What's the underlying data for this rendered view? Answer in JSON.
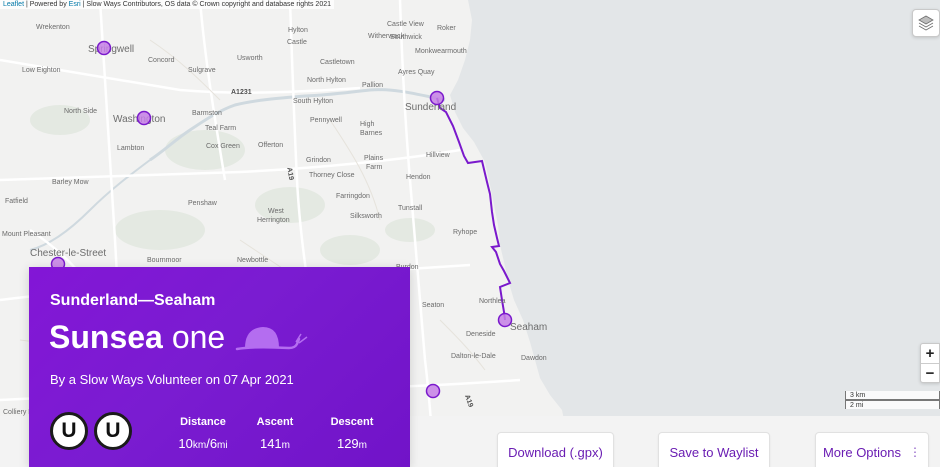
{
  "attribution": {
    "leaflet": "Leaflet",
    "sep1": " | Powered by ",
    "esri": "Esri",
    "rest": " | Slow Ways Contributors, OS data © Crown copyright and database rights 2021"
  },
  "map": {
    "towns": [
      "Sunderland",
      "Washington",
      "Seaham",
      "Chester-le-Street",
      "Springwell"
    ],
    "places": [
      "Wrekenton",
      "Low Eighton",
      "Concord",
      "Sulgrave",
      "Usworth",
      "Hylton Castle",
      "Castletown",
      "Southwick",
      "Monkwearmouth",
      "Roker",
      "North Hylton",
      "South Hylton",
      "Pallion",
      "Ayres Quay",
      "Pennywell",
      "High Barnes",
      "Barmston",
      "North Side",
      "Teal Farm",
      "Lambton",
      "Cox Green",
      "Offerton",
      "Grindon",
      "Plains Farm",
      "Thorney Close",
      "Hillview",
      "Farringdon",
      "Penshaw",
      "West Herrington",
      "Silksworth",
      "Tunstall",
      "Ryhope",
      "Bournmoor",
      "Newbottle",
      "Burdon",
      "Seaton",
      "Northlea",
      "Deneside",
      "Dalton-le-Dale",
      "Dawdon",
      "Barley Mow",
      "Fatfield",
      "Mount Pleasant",
      "Colliery Row",
      "Witherwack",
      "Castle View",
      "Hendon"
    ],
    "roads": [
      "A1231",
      "A19",
      "A19"
    ]
  },
  "scale": {
    "km": "3 km",
    "mi": "2 mi"
  },
  "zoom": {
    "in": "+",
    "out": "−"
  },
  "card": {
    "route": "Sunderland—Seaham",
    "title_main": "Sunsea",
    "title_sub": "one",
    "byline": "By a Slow Ways Volunteer on 07 Apr 2021",
    "badges": [
      "U",
      "U"
    ],
    "stats": {
      "distance": {
        "label": "Distance",
        "value": "10",
        "unit_km": "km",
        "slash": "/",
        "value_mi": "6",
        "unit_mi": "mi"
      },
      "ascent": {
        "label": "Ascent",
        "value": "141",
        "unit": "m"
      },
      "descent": {
        "label": "Descent",
        "value": "129",
        "unit": "m"
      }
    }
  },
  "actions": {
    "download": "Download (.gpx)",
    "waylist": "Save to Waylist",
    "more": "More Options",
    "kebab": "⋮"
  },
  "colors": {
    "route": "#7a19cc",
    "marker": "#c57fe6",
    "sea": "#e3e6e8",
    "land": "#f2f2f1",
    "card": "#7a1cd1"
  }
}
